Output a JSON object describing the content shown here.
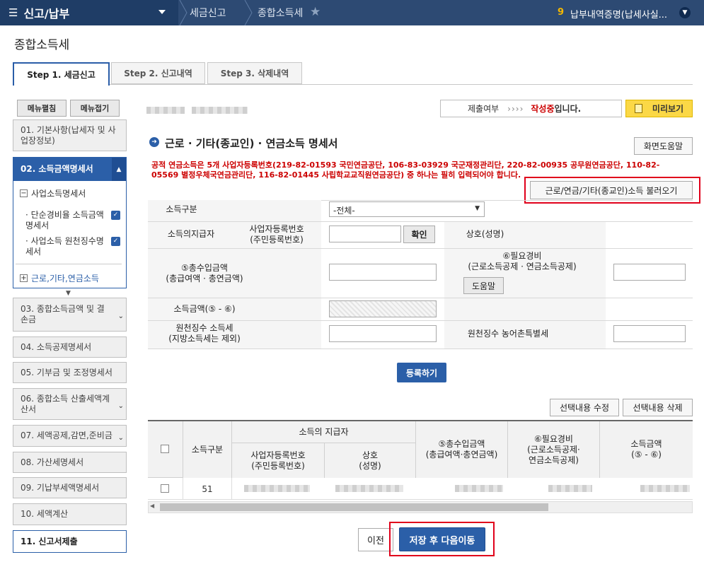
{
  "topbar": {
    "menu_title": "신고/납부",
    "crumbs": [
      "세금신고",
      "종합소득세"
    ],
    "notice_count": "9",
    "notice_text": "납부내역증명(납세사실..."
  },
  "page": {
    "title": "종합소득세"
  },
  "tabs": [
    "Step 1. 세금신고",
    "Step 2. 신고내역",
    "Step 3. 삭제내역"
  ],
  "sidebar": {
    "expand_all": "메뉴펼침",
    "collapse_all": "메뉴접기",
    "items": [
      "01. 기본사항(납세자 및 사업장정보)",
      "02. 소득금액명세서",
      "03. 종합소득금액 및 결손금",
      "04. 소득공제명세서",
      "05. 기부금 및 조정명세서",
      "06. 종합소득 산출세액계산서",
      "07. 세액공제,감면,준비금",
      "08. 가산세명세서",
      "09. 기납부세액명세서",
      "10. 세액계산",
      "11. 신고서제출"
    ],
    "sub_header": "사업소득명세서",
    "sub_items": [
      "단순경비율 소득금액명세서",
      "사업소득 원천징수명세서"
    ],
    "sub_footer": "근로,기타,연금소득"
  },
  "status": {
    "label": "제출여부",
    "arrows": "››››",
    "state_red": "작성중",
    "state_suffix": "입니다.",
    "preview": "미리보기"
  },
  "section": {
    "title": "근로 · 기타(종교인) · 연금소득 명세서",
    "help": "화면도움말",
    "warning": "공적 연금소득은 5개 사업자등록번호(219-82-01593 국민연금공단, 106-83-03929 국군재정관리단, 220-82-00935 공무원연금공단, 110-82-05569 별정우체국연금관리단, 116-82-01445 사립학교교직원연금공단) 중 하나는 필히 입력되어야 합니다.",
    "load_btn": "근로/연금/기타(종교인)소득 불러오기"
  },
  "form": {
    "income_type_label": "소득구분",
    "income_type_value": "-전체-",
    "payer_label": "소득의지급자",
    "bizno_label": "사업자등록번호\n(주민등록번호)",
    "confirm": "확인",
    "name_label": "상호(성명)",
    "total_label": "⑤총수입금액\n(총급여액 · 총연금액)",
    "expense_label": "⑥필요경비\n(근로소득공제 · 연금소득공제)",
    "help_btn": "도움말",
    "income_label": "소득금액(⑤ - ⑥)",
    "withhold_label": "원천징수 소득세\n(지방소득세는 제외)",
    "rural_label": "원천징수 농어촌특별세",
    "register": "등록하기"
  },
  "grid": {
    "edit": "선택내용 수정",
    "delete": "선택내용 삭제",
    "headers": {
      "type": "소득구분",
      "payer_group": "소득의 지급자",
      "bizno": "사업자등록번호\n(주민등록번호)",
      "name": "상호\n(성명)",
      "total": "⑤총수입금액\n(총급여액·총연금액)",
      "expense": "⑥필요경비\n(근로소득공제·\n연금소득공제)",
      "income": "소득금액\n(⑤ - ⑥)"
    },
    "rows": [
      {
        "type": "51"
      }
    ]
  },
  "footer": {
    "prev": "이전",
    "save_next": "저장 후 다음이동"
  }
}
